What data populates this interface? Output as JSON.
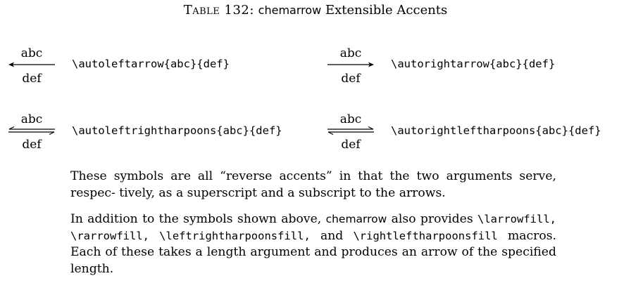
{
  "caption": {
    "table_label": "Table 132:",
    "package": "chemarrow",
    "title_rest": "Extensible Accents"
  },
  "entries": [
    {
      "sup": "abc",
      "sub": "def",
      "arrow": "left-arrow-icon",
      "command": "\\autoleftarrow{abc}{def}"
    },
    {
      "sup": "abc",
      "sub": "def",
      "arrow": "right-arrow-icon",
      "command": "\\autorightarrow{abc}{def}"
    },
    {
      "sup": "abc",
      "sub": "def",
      "arrow": "left-right-harpoons-icon",
      "command": "\\autoleftrightharpoons{abc}{def}"
    },
    {
      "sup": "abc",
      "sub": "def",
      "arrow": "right-left-harpoons-icon",
      "command": "\\autorightleftharpoons{abc}{def}"
    }
  ],
  "paragraph1": {
    "text": "These symbols are all “reverse accents” in that the two arguments serve, respec- tively, as a superscript and a subscript to the arrows."
  },
  "paragraph2": {
    "t1": "In addition to the symbols shown above,",
    "pkg": "chemarrow",
    "t2": "also provides",
    "c1": "\\larrowfill,",
    "c2": "\\rarrowfill,",
    "c3": "\\leftrightharpoonsfill,",
    "t3": "and",
    "c4": "\\rightleftharpoonsfill",
    "t4": "macros. Each of these takes a length argument and produces an arrow of the specified length."
  }
}
